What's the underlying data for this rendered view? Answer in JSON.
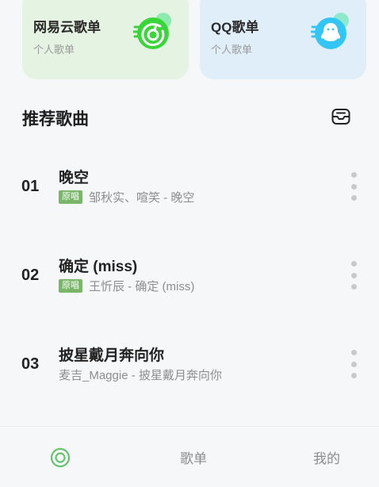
{
  "cards": [
    {
      "title": "网易云歌单",
      "subtitle": "个人歌单",
      "icon": "netease-cloud-music-icon",
      "bg": "#e5f3e2",
      "accent": "#39d63a"
    },
    {
      "title": "QQ歌单",
      "subtitle": "个人歌单",
      "icon": "qq-penguin-icon",
      "bg": "#e0eefa",
      "accent": "#33c6f5"
    }
  ],
  "section": {
    "title": "推荐歌曲",
    "action_icon": "inbox-tray-icon"
  },
  "songs": [
    {
      "num": "01",
      "title": "晚空",
      "badge": "原唱",
      "artist": "邹秋实、喧笑 - 晚空"
    },
    {
      "num": "02",
      "title": "确定 (miss)",
      "badge": "原唱",
      "artist": "王忻辰 - 确定 (miss)"
    },
    {
      "num": "03",
      "title": "披星戴月奔向你",
      "badge": "",
      "artist": "麦吉_Maggie - 披星戴月奔向你"
    }
  ],
  "nav": {
    "home_icon": "target-icon",
    "playlist": "歌单",
    "mine": "我的",
    "active_color": "#63c46b"
  },
  "colors": {
    "badge": "#7ab66a",
    "muted_text": "#8e8e8e"
  }
}
